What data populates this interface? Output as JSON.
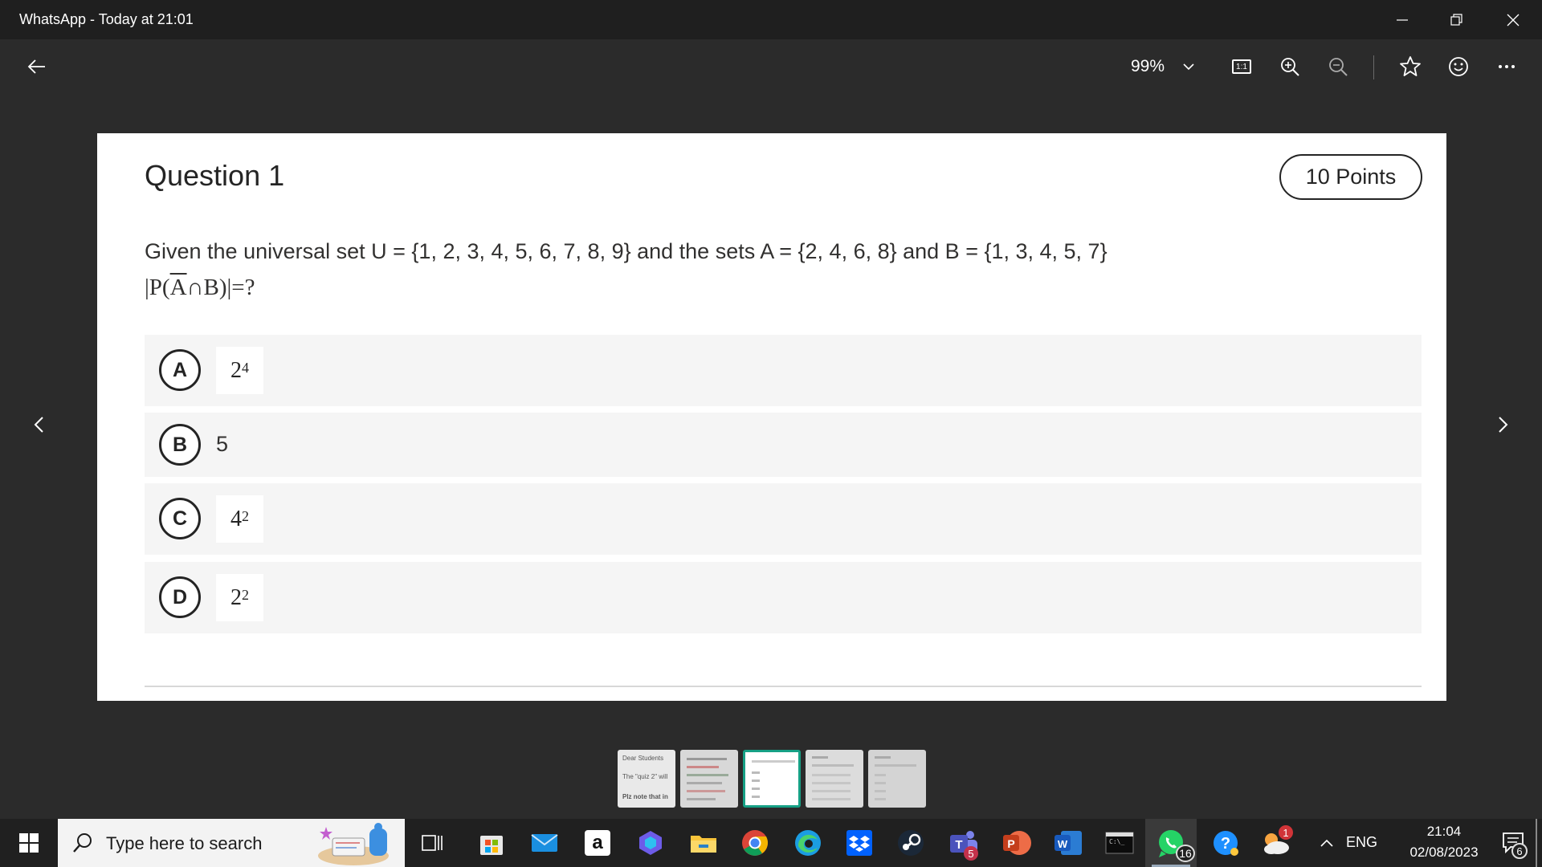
{
  "window": {
    "title": "WhatsApp - Today at 21:01"
  },
  "toolbar": {
    "zoom": "99%",
    "actual_size_label": "1:1"
  },
  "question": {
    "title": "Question 1",
    "points": "10 Points",
    "text": "Given the universal set U = {1, 2, 3, 4, 5, 6, 7, 8, 9} and the sets A = {2, 4, 6, 8} and B = {1, 3, 4, 5, 7}",
    "formula_prefix": "|P(",
    "formula_bar": "A",
    "formula_mid": "∩B)|=?",
    "options": [
      {
        "letter": "A",
        "base": "2",
        "exp": "4"
      },
      {
        "letter": "B",
        "text": "5"
      },
      {
        "letter": "C",
        "base": "4",
        "exp": "2"
      },
      {
        "letter": "D",
        "base": "2",
        "exp": "2"
      }
    ]
  },
  "thumbnails": [
    {
      "line1": "Dear Students",
      "line2": "The \"quiz 2\" will",
      "line3": "Plz note that in"
    }
  ],
  "taskbar": {
    "search_placeholder": "Type here to search",
    "teams_badge": "5",
    "whatsapp_badge": "16",
    "weather_badge": "1",
    "language": "ENG",
    "time": "21:04",
    "date": "02/08/2023",
    "notifications_badge": "6"
  }
}
